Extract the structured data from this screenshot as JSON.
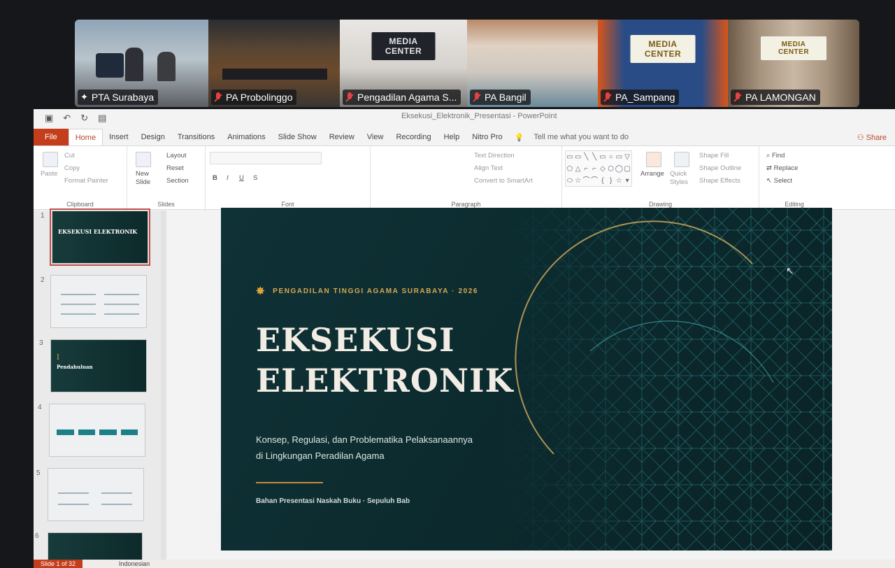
{
  "participants": [
    {
      "name": "PTA Surabaya",
      "active": true,
      "pinned": true
    },
    {
      "name": "PA Probolinggo",
      "muted": true
    },
    {
      "name": "Pengadilan Agama S...",
      "muted": true,
      "sign": "MEDIA CENTER"
    },
    {
      "name": "PA Bangil",
      "muted": true
    },
    {
      "name": "PA_Sampang",
      "muted": true,
      "sign": "MEDIA CENTER"
    },
    {
      "name": "PA LAMONGAN",
      "muted": true,
      "sign": "MEDIA CENTER"
    }
  ],
  "app": {
    "title": "Eksekusi_Elektronik_Presentasi - PowerPoint",
    "tabs": [
      "File",
      "Home",
      "Insert",
      "Design",
      "Transitions",
      "Animations",
      "Slide Show",
      "Review",
      "View",
      "Recording",
      "Help",
      "Nitro Pro"
    ],
    "tell_me": "Tell me what you want to do",
    "share": "Share"
  },
  "ribbon": {
    "clipboard": {
      "paste": "Paste",
      "cut": "Cut",
      "copy": "Copy",
      "format_painter": "Format Painter",
      "label": "Clipboard"
    },
    "slides": {
      "new_slide": "New Slide",
      "layout": "Layout",
      "reset": "Reset",
      "section": "Section",
      "label": "Slides"
    },
    "font": {
      "label": "Font"
    },
    "paragraph": {
      "text_direction": "Text Direction",
      "align_text": "Align Text",
      "smartart": "Convert to SmartArt",
      "label": "Paragraph"
    },
    "drawing": {
      "arrange": "Arrange",
      "quick_styles": "Quick Styles",
      "shape_fill": "Shape Fill",
      "shape_outline": "Shape Outline",
      "shape_effects": "Shape Effects",
      "label": "Drawing"
    },
    "editing": {
      "find": "Find",
      "replace": "Replace",
      "select": "Select",
      "label": "Editing"
    }
  },
  "thumbnails": [
    {
      "num": "1",
      "title": "EKSEKUSI ELEKTRONIK",
      "style": "dark",
      "selected": true
    },
    {
      "num": "2",
      "style": "light"
    },
    {
      "num": "3",
      "title": "Pendahuluan",
      "style": "dark"
    },
    {
      "num": "4",
      "style": "light"
    },
    {
      "num": "5",
      "style": "light"
    },
    {
      "num": "6",
      "style": "dark"
    }
  ],
  "slide": {
    "kicker": "PENGADILAN TINGGI AGAMA SURABAYA · 2026",
    "title_line1": "EKSEKUSI",
    "title_line2": "ELEKTRONIK",
    "subtitle_line1": "Konsep, Regulasi, dan Problematika Pelaksanaannya",
    "subtitle_line2": "di Lingkungan Peradilan Agama",
    "footer": "Bahan Presentasi Naskah Buku · Sepuluh Bab"
  },
  "status": {
    "slide_of": "Slide 1 of 32",
    "language": "Indonesian"
  },
  "colors": {
    "slide_bg": "#0f3236",
    "accent_gold": "#d8a851",
    "file_tab": "#c43e1c",
    "active_speaker": "#3ec15a"
  }
}
